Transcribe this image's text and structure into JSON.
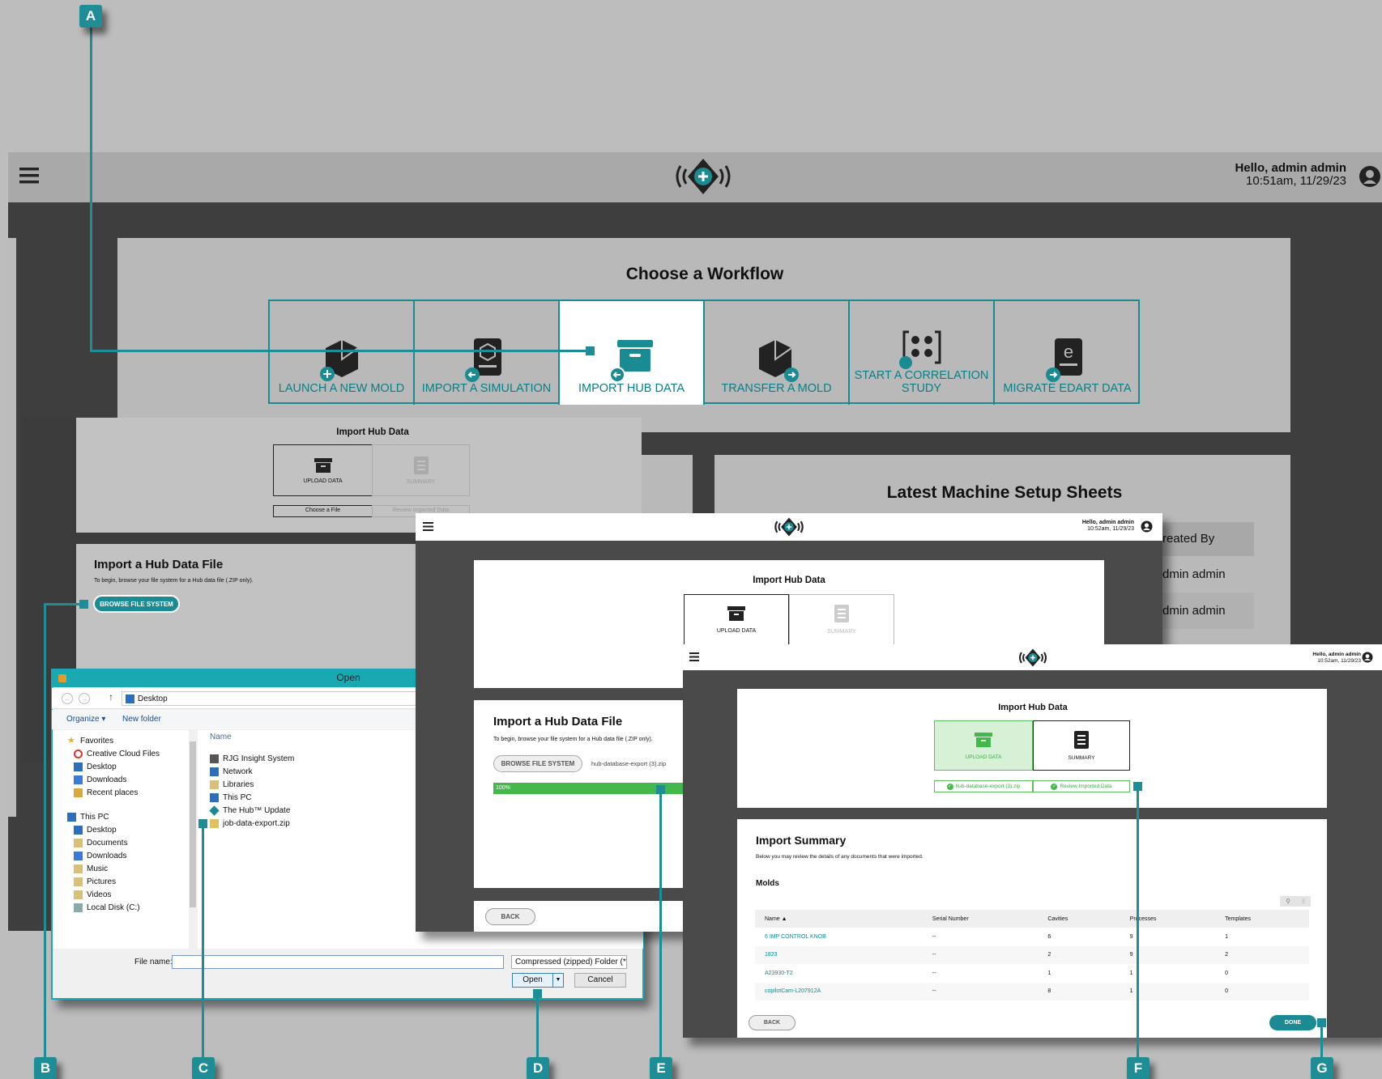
{
  "callouts": {
    "a": "A",
    "b": "B",
    "c": "C",
    "d": "D",
    "e": "E",
    "f": "F",
    "g": "G"
  },
  "main": {
    "user_greeting": "Hello, admin admin",
    "timestamp": "10:51am, 11/29/23",
    "workflow_title": "Choose a Workflow",
    "workflows": [
      {
        "label": "LAUNCH A NEW MOLD"
      },
      {
        "label": "IMPORT A SIMULATION"
      },
      {
        "label": "IMPORT HUB DATA"
      },
      {
        "label": "TRANSFER A MOLD"
      },
      {
        "label": "START A CORRELATION STUDY"
      },
      {
        "label": "MIGRATE EDART DATA"
      }
    ],
    "setup_sheets_title": "Latest Machine Setup Sheets",
    "setup_sheets_col": "reated By",
    "setup_sheets_rows": [
      "dmin admin",
      "dmin admin"
    ]
  },
  "step1": {
    "title": "Import Hub Data",
    "tab_upload": "UPLOAD DATA",
    "tab_summary": "SUMMARY",
    "substep_upload": "Choose a File",
    "substep_summary": "Review Imported Data",
    "card_title": "Import a Hub Data File",
    "card_desc": "To begin, browse your file system for a Hub data file (.ZIP only).",
    "browse_button": "BROWSE FILE SYSTEM"
  },
  "dialog": {
    "title": "Open",
    "path": "Desktop",
    "organize": "Organize ▾",
    "new_folder": "New folder",
    "tree": [
      "Favorites",
      "Creative Cloud Files",
      "Desktop",
      "Downloads",
      "Recent places",
      "This PC",
      "Desktop",
      "Documents",
      "Downloads",
      "Music",
      "Pictures",
      "Videos",
      "Local Disk (C:)"
    ],
    "column_name": "Name",
    "files": [
      "RJG Insight System",
      "Network",
      "Libraries",
      "This PC",
      "The Hub™ Update",
      "job-data-export.zip"
    ],
    "filename_label": "File name:",
    "filename_value": "",
    "filetype": "Compressed (zipped) Folder (*.",
    "open_button": "Open",
    "cancel_button": "Cancel"
  },
  "step2": {
    "user_greeting": "Hello, admin admin",
    "timestamp": "10:52am, 11/29/23",
    "title": "Import Hub Data",
    "tab_upload": "UPLOAD DATA",
    "tab_summary": "SUMMARY",
    "card_title": "Import a Hub Data File",
    "card_desc": "To begin, browse your file system for a Hub data file (.ZIP only).",
    "browse_button": "BROWSE FILE SYSTEM",
    "filename": "hub-database-export (3).zip",
    "progress_label": "100%",
    "progress": 100,
    "back_button": "BACK"
  },
  "step3": {
    "user_greeting": "Hello, admin admin",
    "timestamp": "10:52am, 11/29/23",
    "title": "Import Hub Data",
    "tab_upload": "UPLOAD DATA",
    "tab_summary": "SUMMARY",
    "substep_upload": "hub-database-export (3).zip",
    "substep_summary": "Review Imported Data",
    "summary_title": "Import Summary",
    "summary_desc": "Below you may review the details of any documents that were imported.",
    "molds_heading": "Molds",
    "columns": [
      "Name ▲",
      "Serial Number",
      "Cavities",
      "Processes",
      "Templates"
    ],
    "rows": [
      [
        "6 IMP CONTROL KNOB",
        "--",
        "6",
        "9",
        "1"
      ],
      [
        "1823",
        "--",
        "2",
        "9",
        "2"
      ],
      [
        "A23930-T2",
        "--",
        "1",
        "1",
        "0"
      ],
      [
        "copilotCam-L207912A",
        "--",
        "8",
        "1",
        "0"
      ]
    ],
    "back_button": "BACK",
    "done_button": "DONE"
  }
}
